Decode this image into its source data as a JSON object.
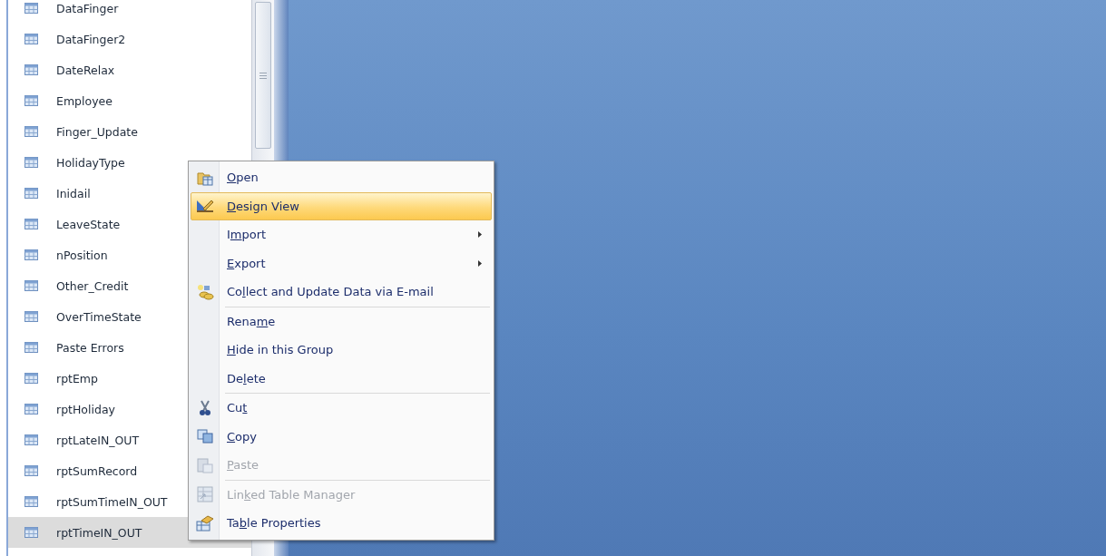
{
  "navigation_pane": {
    "items": [
      {
        "label": "DataFinger",
        "selected": false
      },
      {
        "label": "DataFinger2",
        "selected": false
      },
      {
        "label": "DateRelax",
        "selected": false
      },
      {
        "label": "Employee",
        "selected": false
      },
      {
        "label": "Finger_Update",
        "selected": false
      },
      {
        "label": "HolidayType",
        "selected": false
      },
      {
        "label": "Inidail",
        "selected": false
      },
      {
        "label": "LeaveState",
        "selected": false
      },
      {
        "label": "nPosition",
        "selected": false
      },
      {
        "label": "Other_Credit",
        "selected": false
      },
      {
        "label": "OverTimeState",
        "selected": false
      },
      {
        "label": "Paste Errors",
        "selected": false
      },
      {
        "label": "rptEmp",
        "selected": false
      },
      {
        "label": "rptHoliday",
        "selected": false
      },
      {
        "label": "rptLateIN_OUT",
        "selected": false
      },
      {
        "label": "rptSumRecord",
        "selected": false
      },
      {
        "label": "rptSumTimeIN_OUT",
        "selected": false
      },
      {
        "label": "rptTimeIN_OUT",
        "selected": true
      }
    ]
  },
  "context_menu": {
    "items": [
      {
        "kind": "item",
        "key": "O",
        "after": "pen",
        "selected": false,
        "disabled": false,
        "submenu": false
      },
      {
        "kind": "item",
        "key": "D",
        "after": "esign View",
        "selected": true,
        "disabled": false,
        "submenu": false
      },
      {
        "kind": "item",
        "before": "I",
        "key": "m",
        "after": "port",
        "selected": false,
        "disabled": false,
        "submenu": true
      },
      {
        "kind": "item",
        "key": "E",
        "after": "xport",
        "selected": false,
        "disabled": false,
        "submenu": true
      },
      {
        "kind": "item",
        "before": "Co",
        "key": "l",
        "after": "lect and Update Data via E-mail",
        "selected": false,
        "disabled": false,
        "submenu": false
      },
      {
        "kind": "separator"
      },
      {
        "kind": "item",
        "before": "Rena",
        "key": "m",
        "after": "e",
        "selected": false,
        "disabled": false,
        "submenu": false
      },
      {
        "kind": "item",
        "key": "H",
        "after": "ide in this Group",
        "selected": false,
        "disabled": false,
        "submenu": false
      },
      {
        "kind": "item",
        "before": "De",
        "key": "l",
        "after": "ete",
        "selected": false,
        "disabled": false,
        "submenu": false
      },
      {
        "kind": "separator"
      },
      {
        "kind": "item",
        "before": "Cu",
        "key": "t",
        "selected": false,
        "disabled": false,
        "submenu": false
      },
      {
        "kind": "item",
        "key": "C",
        "after": "opy",
        "selected": false,
        "disabled": false,
        "submenu": false
      },
      {
        "kind": "item",
        "key": "P",
        "after": "aste",
        "selected": false,
        "disabled": true,
        "submenu": false
      },
      {
        "kind": "separator"
      },
      {
        "kind": "item",
        "before": "Lin",
        "key": "k",
        "after": "ed Table Manager",
        "selected": false,
        "disabled": true,
        "submenu": false
      },
      {
        "kind": "item",
        "before": "Ta",
        "key": "b",
        "after": "le Properties",
        "selected": false,
        "disabled": false,
        "submenu": false
      }
    ]
  }
}
